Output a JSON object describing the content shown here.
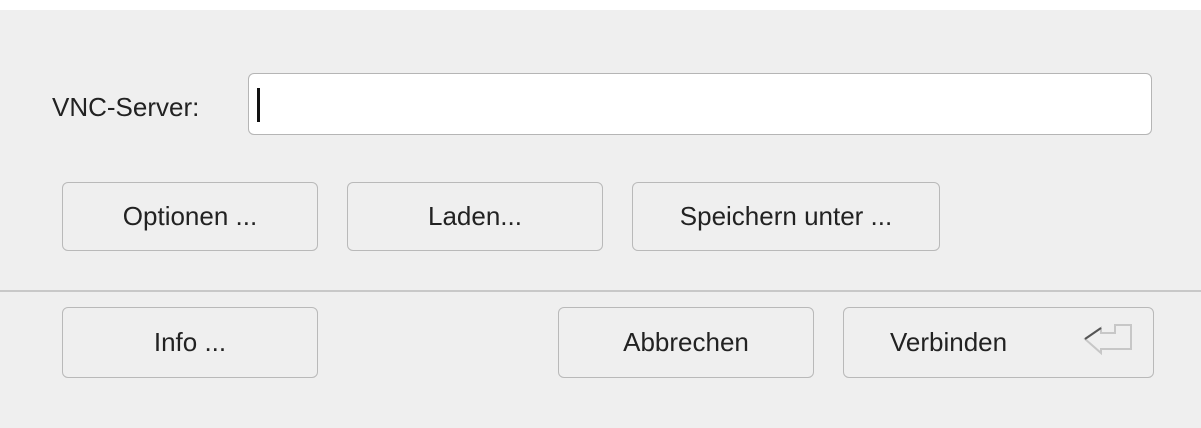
{
  "server": {
    "label": "VNC-Server:",
    "value": ""
  },
  "buttons": {
    "options": "Optionen ...",
    "load": "Laden...",
    "save_as": "Speichern unter ...",
    "info": "Info ...",
    "cancel": "Abbrechen",
    "connect": "Verbinden"
  },
  "icons": {
    "connect_default": "enter-key-icon"
  }
}
